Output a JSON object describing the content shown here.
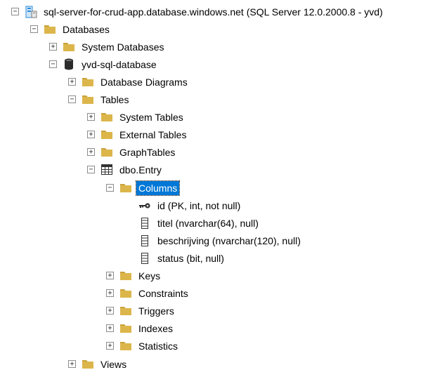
{
  "tree": {
    "nodes": [
      {
        "id": "server",
        "label": "sql-server-for-crud-app.database.windows.net (SQL Server 12.0.2000.8 - yvd)",
        "icon": "server-icon",
        "level": 0,
        "expander": "minus",
        "selected": false
      },
      {
        "id": "databases",
        "label": "Databases",
        "icon": "folder-icon",
        "level": 1,
        "expander": "minus",
        "selected": false
      },
      {
        "id": "system-databases",
        "label": "System Databases",
        "icon": "folder-icon",
        "level": 2,
        "expander": "plus",
        "selected": false
      },
      {
        "id": "yvd-sql-database",
        "label": "yvd-sql-database",
        "icon": "database-icon",
        "level": 2,
        "expander": "minus",
        "selected": false
      },
      {
        "id": "database-diagrams",
        "label": "Database Diagrams",
        "icon": "folder-icon",
        "level": 3,
        "expander": "plus",
        "selected": false
      },
      {
        "id": "tables",
        "label": "Tables",
        "icon": "folder-icon",
        "level": 3,
        "expander": "minus",
        "selected": false
      },
      {
        "id": "system-tables",
        "label": "System Tables",
        "icon": "folder-icon",
        "level": 4,
        "expander": "plus",
        "selected": false
      },
      {
        "id": "external-tables",
        "label": "External Tables",
        "icon": "folder-icon",
        "level": 4,
        "expander": "plus",
        "selected": false
      },
      {
        "id": "graph-tables",
        "label": "GraphTables",
        "icon": "folder-icon",
        "level": 4,
        "expander": "plus",
        "selected": false
      },
      {
        "id": "dbo-entry",
        "label": "dbo.Entry",
        "icon": "table-icon",
        "level": 4,
        "expander": "minus",
        "selected": false
      },
      {
        "id": "columns",
        "label": "Columns",
        "icon": "folder-icon",
        "level": 5,
        "expander": "minus",
        "selected": true
      },
      {
        "id": "col-id",
        "label": "id (PK, int, not null)",
        "icon": "key-icon",
        "level": 6,
        "expander": "none",
        "selected": false
      },
      {
        "id": "col-titel",
        "label": "titel (nvarchar(64), null)",
        "icon": "column-icon",
        "level": 6,
        "expander": "none",
        "selected": false
      },
      {
        "id": "col-beschrijving",
        "label": "beschrijving (nvarchar(120), null)",
        "icon": "column-icon",
        "level": 6,
        "expander": "none",
        "selected": false
      },
      {
        "id": "col-status",
        "label": "status (bit, null)",
        "icon": "column-icon",
        "level": 6,
        "expander": "none",
        "selected": false
      },
      {
        "id": "keys",
        "label": "Keys",
        "icon": "folder-icon",
        "level": 5,
        "expander": "plus",
        "selected": false
      },
      {
        "id": "constraints",
        "label": "Constraints",
        "icon": "folder-icon",
        "level": 5,
        "expander": "plus",
        "selected": false
      },
      {
        "id": "triggers",
        "label": "Triggers",
        "icon": "folder-icon",
        "level": 5,
        "expander": "plus",
        "selected": false
      },
      {
        "id": "indexes",
        "label": "Indexes",
        "icon": "folder-icon",
        "level": 5,
        "expander": "plus",
        "selected": false
      },
      {
        "id": "statistics",
        "label": "Statistics",
        "icon": "folder-icon",
        "level": 5,
        "expander": "plus",
        "selected": false
      },
      {
        "id": "views",
        "label": "Views",
        "icon": "folder-icon",
        "level": 3,
        "expander": "plus",
        "selected": false
      }
    ]
  },
  "colors": {
    "folder": "#dcb64a",
    "folder_tab": "#c9a23a",
    "selection": "#0078d7",
    "server": "#2e8bd8",
    "database": "#2b2b2b"
  }
}
